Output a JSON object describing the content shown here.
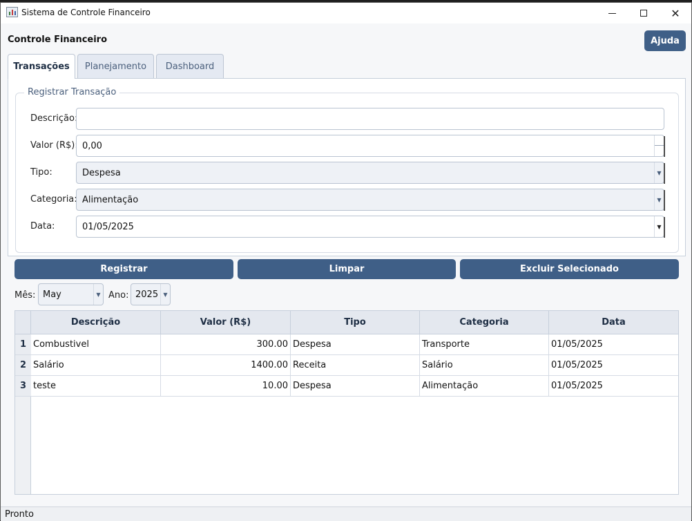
{
  "window": {
    "title": "Sistema de Controle Financeiro",
    "icon": "chart-app-icon"
  },
  "header": {
    "title": "Controle Financeiro",
    "help_label": "Ajuda"
  },
  "tabs": [
    {
      "label": "Transações",
      "active": true
    },
    {
      "label": "Planejamento",
      "active": false
    },
    {
      "label": "Dashboard",
      "active": false
    }
  ],
  "form": {
    "group_title": "Registrar Transação",
    "fields": {
      "descricao": {
        "label": "Descrição:",
        "value": ""
      },
      "valor": {
        "label": "Valor (R$):",
        "value": "0,00"
      },
      "tipo": {
        "label": "Tipo:",
        "value": "Despesa"
      },
      "categoria": {
        "label": "Categoria:",
        "value": "Alimentação"
      },
      "data": {
        "label": "Data:",
        "value": "01/05/2025"
      }
    }
  },
  "actions": {
    "register_label": "Registrar",
    "clear_label": "Limpar",
    "delete_label": "Excluir Selecionado"
  },
  "filters": {
    "month_label": "Mês:",
    "month_value": "May",
    "year_label": "Ano:",
    "year_value": "2025"
  },
  "table": {
    "columns": [
      "Descrição",
      "Valor (R$)",
      "Tipo",
      "Categoria",
      "Data"
    ],
    "rows": [
      {
        "num": "1",
        "descricao": "Combustivel",
        "valor": "300.00",
        "tipo": "Despesa",
        "categoria": "Transporte",
        "data": "01/05/2025"
      },
      {
        "num": "2",
        "descricao": "Salário",
        "valor": "1400.00",
        "tipo": "Receita",
        "categoria": "Salário",
        "data": "01/05/2025"
      },
      {
        "num": "3",
        "descricao": "teste",
        "valor": "10.00",
        "tipo": "Despesa",
        "categoria": "Alimentação",
        "data": "01/05/2025"
      }
    ]
  },
  "status": {
    "text": "Pronto"
  },
  "colors": {
    "accent": "#3f5f87",
    "header_bg": "#e4e8ef"
  }
}
